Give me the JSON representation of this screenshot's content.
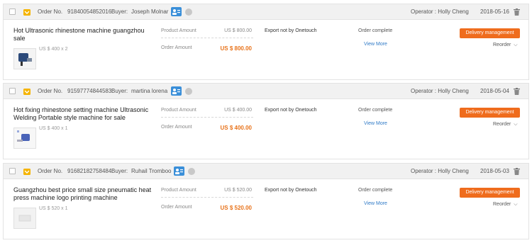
{
  "labels": {
    "order_no": "Order No.",
    "buyer": "Buyer:",
    "product_amount": "Product Amount",
    "order_amount": "Order Amount",
    "view_more": "View More",
    "delivery_button": "Delivery management",
    "reorder": "Reorder",
    "chevron": "⌵"
  },
  "colors": {
    "accent": "#ef6c1d",
    "link": "#2f7ac7",
    "amount": "#e8731b"
  },
  "orders": [
    {
      "order_no": "91840054852016",
      "buyer": "Joseph Molnar",
      "operator": "Operator : Holly Cheng",
      "date": "2018-05-16",
      "title": "Hot Ultrasonic rhinestone machine guangzhou sale",
      "unit_price": "US $ 400 x 2",
      "product_amount": "US $ 800.00",
      "order_amount": "US $ 800.00",
      "export": "Export not by Onetouch",
      "status": "Order complete"
    },
    {
      "order_no": "91597774844583",
      "buyer": "martina lorena",
      "operator": "Operator : Holly Cheng",
      "date": "2018-05-04",
      "title": "Hot fixing rhinestone setting machine Ultrasonic Welding Portable style machine for sale",
      "unit_price": "US $ 400 x 1",
      "product_amount": "US $ 400.00",
      "order_amount": "US $ 400.00",
      "export": "Export not by Onetouch",
      "status": "Order complete"
    },
    {
      "order_no": "91682182758484",
      "buyer": "Ruhail Tromboo",
      "operator": "Operator : Holly Cheng",
      "date": "2018-05-03",
      "title": "Guangzhou best price small size pneumatic heat press machine logo printing machine",
      "unit_price": "US $ 520 x 1",
      "product_amount": "US $ 520.00",
      "order_amount": "US $ 520.00",
      "export": "Export not by Onetouch",
      "status": "Order complete"
    }
  ]
}
